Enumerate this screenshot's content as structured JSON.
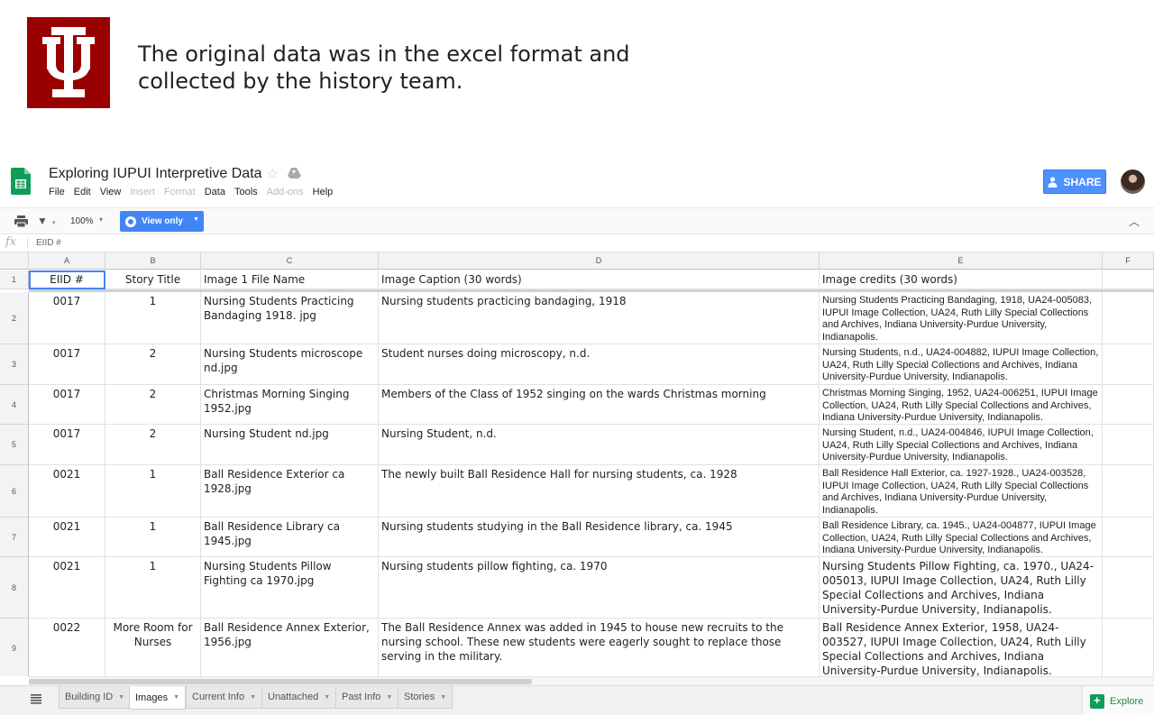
{
  "slide": {
    "headline": "The original data was in the excel format and collected by the history team."
  },
  "colors": {
    "logo_crimson": "#990000",
    "share_blue": "#4d90fe",
    "view_only_blue": "#4285f4",
    "explore_green": "#0f9d58"
  },
  "doc": {
    "title": "Exploring IUPUI Interpretive Data",
    "menu": [
      {
        "label": "File",
        "enabled": true
      },
      {
        "label": "Edit",
        "enabled": true
      },
      {
        "label": "View",
        "enabled": true
      },
      {
        "label": "Insert",
        "enabled": false
      },
      {
        "label": "Format",
        "enabled": false
      },
      {
        "label": "Data",
        "enabled": true
      },
      {
        "label": "Tools",
        "enabled": true
      },
      {
        "label": "Add-ons",
        "enabled": false
      },
      {
        "label": "Help",
        "enabled": true
      }
    ],
    "share_label": "SHARE"
  },
  "toolbar": {
    "zoom": "100%",
    "view_only_label": "View only"
  },
  "formula_bar": {
    "fx_label": "fx",
    "value": "EIID #"
  },
  "sheet": {
    "columns": [
      "A",
      "B",
      "C",
      "D",
      "E",
      "F"
    ],
    "header_row": {
      "row_number": "1",
      "cells": [
        "EIID #",
        "Story Title",
        "Image 1 File Name",
        "Image Caption (30 words)",
        "Image credits (30 words)",
        ""
      ]
    },
    "rows": [
      {
        "row_number": "2",
        "id": "0017",
        "story": "1",
        "file": "Nursing Students Practicing Bandaging 1918. jpg",
        "caption": "Nursing students practicing bandaging, 1918",
        "credits": "Nursing Students Practicing Bandaging, 1918, UA24-005083, IUPUI Image Collection, UA24, Ruth Lilly Special Collections and Archives, Indiana University-Purdue University, Indianapolis.",
        "credits_style": "small"
      },
      {
        "row_number": "3",
        "id": "0017",
        "story": "2",
        "file": "Nursing Students microscope nd.jpg",
        "caption": "Student nurses doing microscopy, n.d.",
        "credits": "Nursing Students, n.d., UA24-004882, IUPUI Image Collection, UA24, Ruth Lilly Special Collections and Archives, Indiana University-Purdue University, Indianapolis.",
        "credits_style": "small"
      },
      {
        "row_number": "4",
        "id": "0017",
        "story": "2",
        "file": "Christmas Morning Singing 1952.jpg",
        "caption": "Members of the Class of 1952 singing on the wards Christmas morning",
        "credits": "Christmas Morning Singing, 1952, UA24-006251, IUPUI Image Collection, UA24, Ruth Lilly Special Collections and Archives, Indiana University-Purdue University, Indianapolis.",
        "credits_style": "small"
      },
      {
        "row_number": "5",
        "id": "0017",
        "story": "2",
        "file": "Nursing Student nd.jpg",
        "caption": "Nursing Student, n.d.",
        "credits": "Nursing Student, n.d., UA24-004846, IUPUI Image Collection, UA24, Ruth Lilly Special Collections and Archives, Indiana University-Purdue University, Indianapolis.",
        "credits_style": "small"
      },
      {
        "row_number": "6",
        "id": "0021",
        "story": "1",
        "file": "Ball Residence Exterior ca 1928.jpg",
        "caption": "The newly built Ball Residence Hall for nursing students, ca. 1928",
        "credits": "Ball Residence Hall Exterior, ca. 1927-1928., UA24-003528, IUPUI Image Collection, UA24, Ruth Lilly Special Collections and Archives, Indiana University-Purdue University, Indianapolis.",
        "credits_style": "small"
      },
      {
        "row_number": "7",
        "id": "0021",
        "story": "1",
        "file": "Ball Residence Library ca 1945.jpg",
        "caption": "Nursing students studying in the Ball Residence library, ca. 1945",
        "credits": "Ball Residence Library, ca. 1945., UA24-004877, IUPUI Image Collection, UA24, Ruth Lilly Special Collections and Archives, Indiana University-Purdue University, Indianapolis.",
        "credits_style": "small"
      },
      {
        "row_number": "8",
        "id": "0021",
        "story": "1",
        "file": "Nursing Students Pillow Fighting ca 1970.jpg",
        "caption": "Nursing students pillow fighting, ca. 1970",
        "credits": "Nursing Students Pillow Fighting, ca. 1970., UA24-005013,  IUPUI Image Collection, UA24, Ruth Lilly Special Collections and Archives, Indiana University-Purdue University, Indianapolis.",
        "credits_style": "normal"
      },
      {
        "row_number": "9",
        "id": "0022",
        "story": "More Room for Nurses",
        "file": "Ball Residence Annex Exterior, 1956.jpg",
        "caption": "The Ball Residence Annex was added in 1945 to house new recruits to the nursing school. These new students were eagerly sought to replace those serving in the military.",
        "credits": "Ball Residence Annex Exterior, 1958, UA24-003527, IUPUI Image Collection, UA24, Ruth Lilly Special Collections and Archives, Indiana University-Purdue University, Indianapolis.",
        "credits_style": "normal"
      }
    ]
  },
  "tabs": [
    {
      "label": "Building ID",
      "active": false
    },
    {
      "label": "Images",
      "active": true
    },
    {
      "label": "Current Info",
      "active": false
    },
    {
      "label": "Unattached",
      "active": false
    },
    {
      "label": "Past Info",
      "active": false
    },
    {
      "label": "Stories",
      "active": false
    }
  ],
  "explore_label": "Explore"
}
